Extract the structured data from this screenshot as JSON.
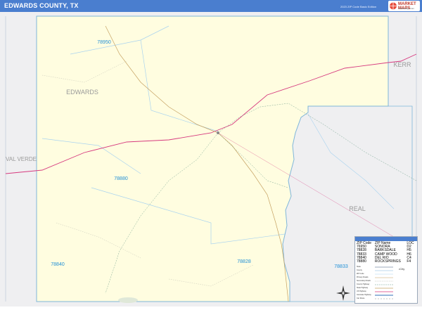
{
  "header": {
    "title": "EDWARDS COUNTY, TX",
    "edition": "2023 ZIP Code Basic Edition",
    "logo_word": "MARKET",
    "logo_word2": "MAPS",
    "logo_sub": "marketmaps.com"
  },
  "map": {
    "county_name": "EDWARDS",
    "neighbors": {
      "west": "VAL VERDE",
      "east": "KERR",
      "southeast": "REAL"
    },
    "zip_labels": [
      "78950",
      "78880",
      "78840",
      "78828",
      "78833"
    ]
  },
  "legend": {
    "columns": [
      "ZIP Code",
      "ZIP Name",
      "LOC"
    ],
    "rows": [
      [
        "76950",
        "SONORA",
        "D2"
      ],
      [
        "78828",
        "BARKSDALE",
        "H5"
      ],
      [
        "78833",
        "CAMP WOOD",
        "H6"
      ],
      [
        "78840",
        "DEL RIO",
        "C4"
      ],
      [
        "78880",
        "ROCKSPRINGS",
        "F4"
      ]
    ],
    "key_items": [
      "State",
      "County",
      "ZIP Code",
      "Primary Roads",
      "Secondary Roads",
      "County Highway",
      "State Highway",
      "US Highway",
      "Interstate Highway",
      "Car Route"
    ],
    "city_note": "City"
  },
  "colors": {
    "title_bar": "#4a7ecf",
    "county_fill": "#fffde0",
    "neighbor_fill": "#efeff1",
    "county_border": "#7fb6d9",
    "us_highway": "#d6397e",
    "state_highway": "#c5a060",
    "zip_label": "#1f8fd6"
  }
}
